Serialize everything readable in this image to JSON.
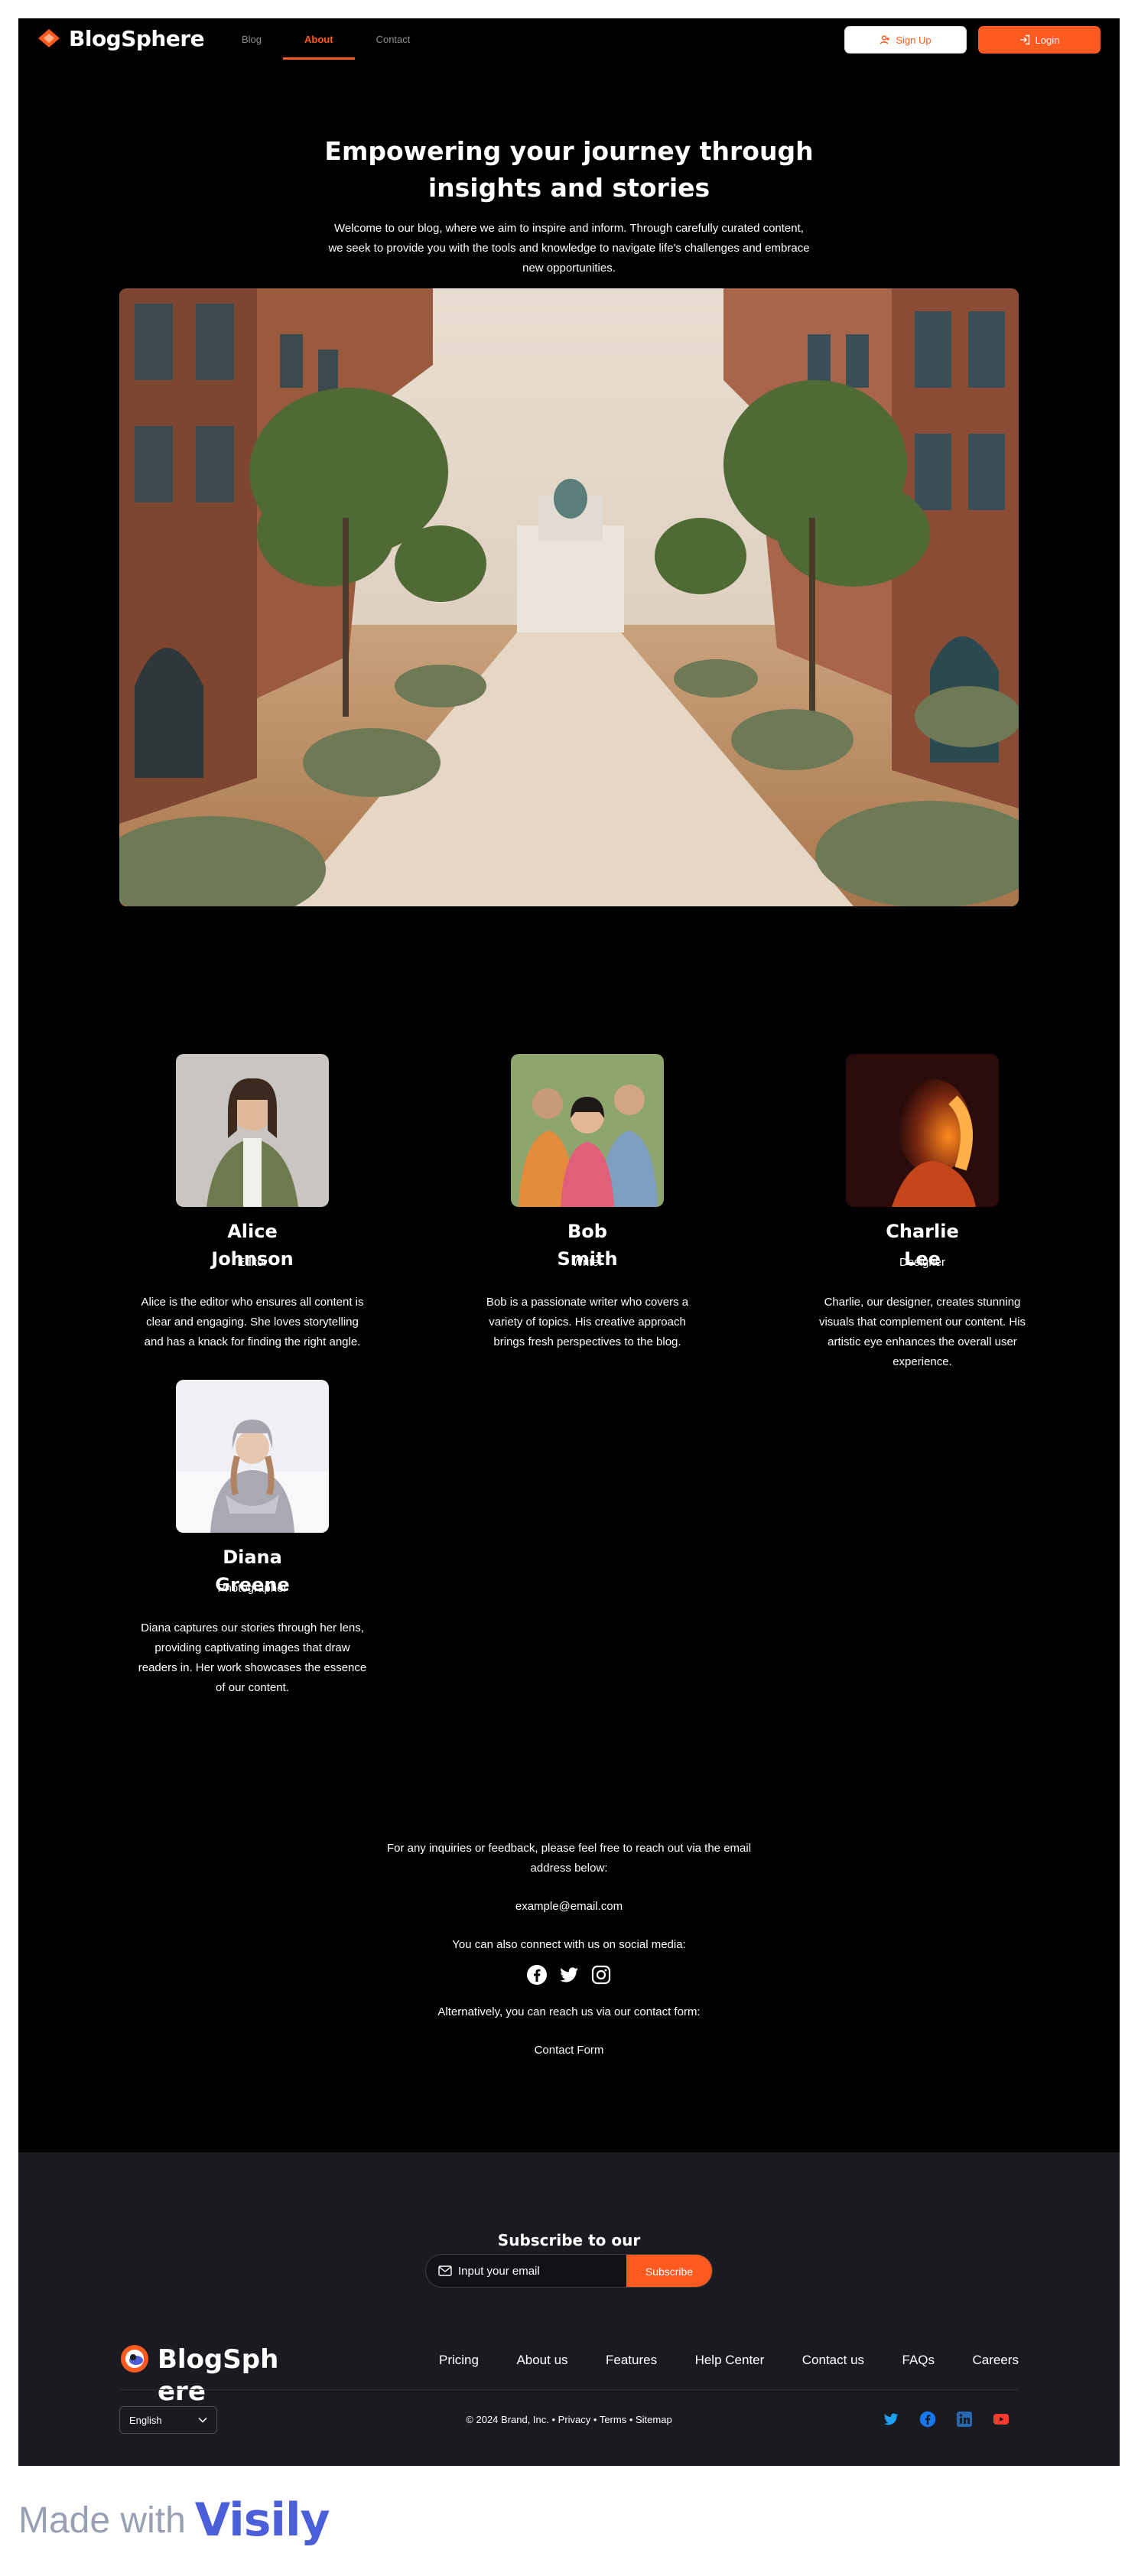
{
  "brand": {
    "name": "BlogSphere",
    "accent": "#ff5a1f"
  },
  "nav": {
    "links": [
      {
        "label": "Blog"
      },
      {
        "label": "About",
        "active": true
      },
      {
        "label": "Contact"
      }
    ],
    "signup_label": "Sign Up",
    "login_label": "Login"
  },
  "hero": {
    "title": "Empowering your journey through insights and stories",
    "subtitle": "Welcome to our blog, where we aim to inspire and inform. Through carefully curated content, we seek to provide you with the tools and knowledge to navigate life's challenges and embrace new opportunities."
  },
  "team": [
    {
      "name": "Alice Johnson",
      "role": "Editor",
      "bio": "Alice is the editor who ensures all content is clear and engaging. She loves storytelling and has a knack for finding the right angle."
    },
    {
      "name": "Bob Smith",
      "role": "Writer",
      "bio": "Bob is a passionate writer who covers a variety of topics. His creative approach brings fresh perspectives to the blog."
    },
    {
      "name": "Charlie Lee",
      "role": "Designer",
      "bio": "Charlie, our designer, creates stunning visuals that complement our content. His artistic eye enhances the overall user experience."
    },
    {
      "name": "Diana Greene",
      "role": "Photographer",
      "bio": "Diana captures our stories through her lens, providing captivating images that draw readers in. Her work showcases the essence of our content."
    }
  ],
  "contact": {
    "intro": "For any inquiries or feedback, please feel free to reach out via the email address below:",
    "email": "example@email.com",
    "social_text": "You can also connect with us on social media:",
    "social_icons": [
      "facebook-icon",
      "twitter-icon",
      "instagram-icon"
    ],
    "form_text": "Alternatively, you can reach us via our contact form:",
    "form_link": "Contact Form"
  },
  "footer": {
    "newsletter_title": "Subscribe to our newsletter",
    "email_placeholder": "Input your email",
    "subscribe_label": "Subscribe",
    "brand": "BlogSphere",
    "links": [
      "Pricing",
      "About us",
      "Features",
      "Help Center",
      "Contact us",
      "FAQs",
      "Careers"
    ],
    "language": "English",
    "copyright": "© 2024 Brand, Inc. • Privacy • Terms • Sitemap",
    "social_icons": [
      {
        "icon": "twitter-icon",
        "color": "#1da1f2"
      },
      {
        "icon": "facebook-icon",
        "color": "#1877f2"
      },
      {
        "icon": "linkedin-icon",
        "color": "#2867b2"
      },
      {
        "icon": "youtube-icon",
        "color": "#ff3b30"
      }
    ]
  },
  "made_with": {
    "prefix": "Made with",
    "brand": "Visily"
  }
}
